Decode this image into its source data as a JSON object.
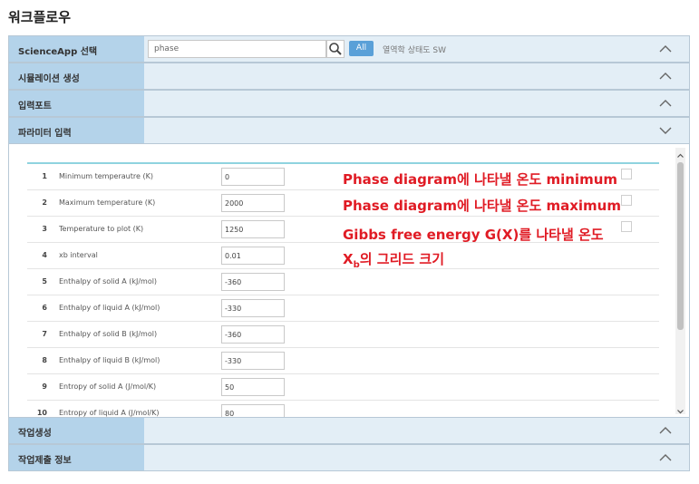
{
  "page_title": "워크플로우",
  "sections": {
    "scienceapp": {
      "label": "ScienceApp 선택",
      "search_value": "phase",
      "all_button": "All",
      "hint": "열역학 상태도 SW"
    },
    "simulation": {
      "label": "시뮬레이션 생성"
    },
    "input_port": {
      "label": "입력포트"
    },
    "parameters": {
      "label": "파라미터 입력"
    },
    "job_create": {
      "label": "작업생성"
    },
    "job_submit": {
      "label": "작업제출 정보"
    }
  },
  "params": [
    {
      "num": "1",
      "name": "Minimum temperautre (K)",
      "value": "0"
    },
    {
      "num": "2",
      "name": "Maximum temperature (K)",
      "value": "2000"
    },
    {
      "num": "3",
      "name": "Temperature to plot (K)",
      "value": "1250"
    },
    {
      "num": "4",
      "name": "xb interval",
      "value": "0.01"
    },
    {
      "num": "5",
      "name": "Enthalpy of solid A (kJ/mol)",
      "value": "-360"
    },
    {
      "num": "6",
      "name": "Enthalpy of liquid A (kJ/mol)",
      "value": "-330"
    },
    {
      "num": "7",
      "name": "Enthalpy of solid B (kJ/mol)",
      "value": "-360"
    },
    {
      "num": "8",
      "name": "Enthalpy of liquid B (kJ/mol)",
      "value": "-330"
    },
    {
      "num": "9",
      "name": "Entropy of solid A (J/mol/K)",
      "value": "50"
    },
    {
      "num": "10",
      "name": "Entropy of liquid A (J/mol/K)",
      "value": "80"
    }
  ],
  "annotations": {
    "line1": "Phase diagram에 나타낼 온도 minimum",
    "line2": "Phase diagram에 나타낼 온도 maximum",
    "line3": "Gibbs free energy G(X)를 나타낼 온도",
    "line4_main": "X",
    "line4_sub": "b",
    "line4_rest": "의 그리드 크기"
  },
  "icons": {
    "chevron_up": "chevron-up-icon",
    "chevron_down": "chevron-down-icon",
    "search": "search-icon"
  },
  "colors": {
    "label_bg": "#b4d3ea",
    "bar_bg": "#e3eef6",
    "all_button": "#5aa0d8",
    "annotation": "#e01b24",
    "accent_line": "#8fd3df"
  }
}
